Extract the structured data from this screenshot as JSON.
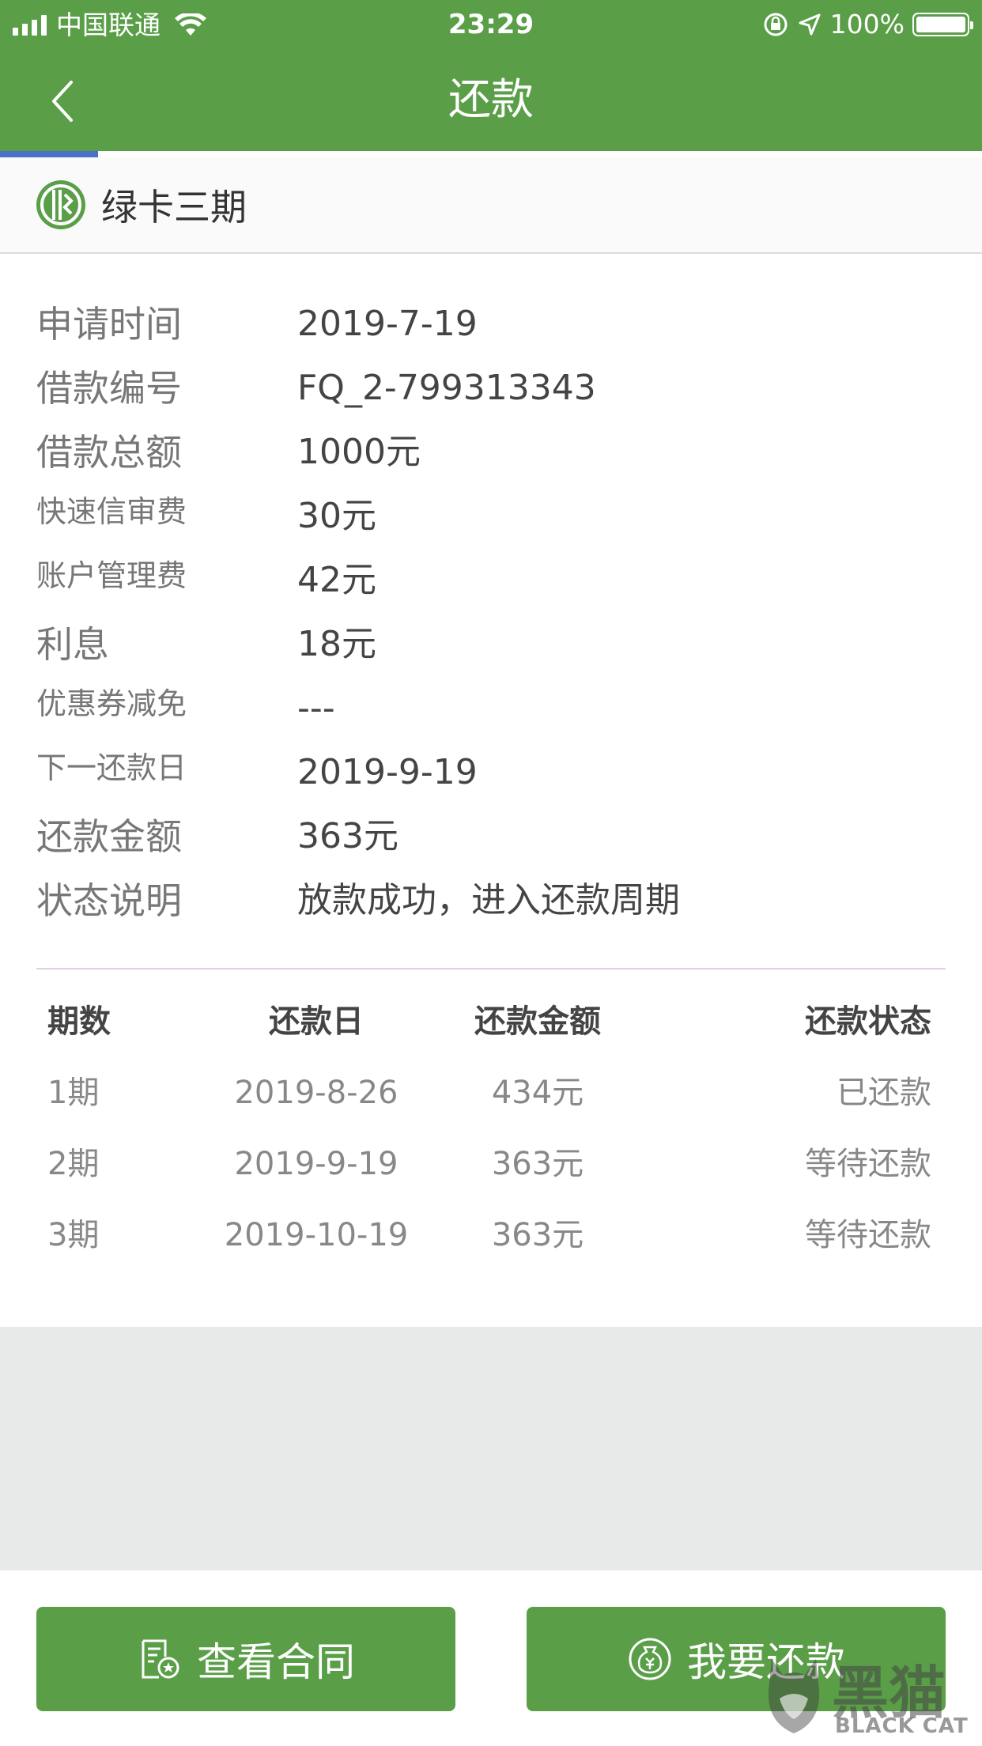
{
  "status_bar": {
    "carrier": "中国联通",
    "time": "23:29",
    "battery": "100%"
  },
  "nav": {
    "title": "还款"
  },
  "product": {
    "name": "绿卡三期"
  },
  "details": [
    {
      "label": "申请时间",
      "value": "2019-7-19"
    },
    {
      "label": "借款编号",
      "value": "FQ_2-799313343"
    },
    {
      "label": "借款总额",
      "value": "1000元"
    },
    {
      "label": "快速信审费",
      "value": "30元"
    },
    {
      "label": "账户管理费",
      "value": "42元"
    },
    {
      "label": "利息",
      "value": "18元"
    },
    {
      "label": "优惠券减免",
      "value": "---"
    },
    {
      "label": "下一还款日",
      "value": "2019-9-19"
    },
    {
      "label": "还款金额",
      "value": "363元"
    },
    {
      "label": "状态说明",
      "value": "放款成功，进入还款周期"
    }
  ],
  "schedule": {
    "headers": [
      "期数",
      "还款日",
      "还款金额",
      "还款状态"
    ],
    "rows": [
      [
        "1期",
        "2019-8-26",
        "434元",
        "已还款"
      ],
      [
        "2期",
        "2019-9-19",
        "363元",
        "等待还款"
      ],
      [
        "3期",
        "2019-10-19",
        "363元",
        "等待还款"
      ]
    ]
  },
  "actions": {
    "contract_label": "查看合同",
    "repay_label": "我要还款"
  },
  "watermark": {
    "cn": "黑猫",
    "en": "BLACK CAT"
  },
  "colors": {
    "brand_green": "#5a9e48",
    "accent_blue": "#4a73c7",
    "divider": "#e1cfe3"
  }
}
